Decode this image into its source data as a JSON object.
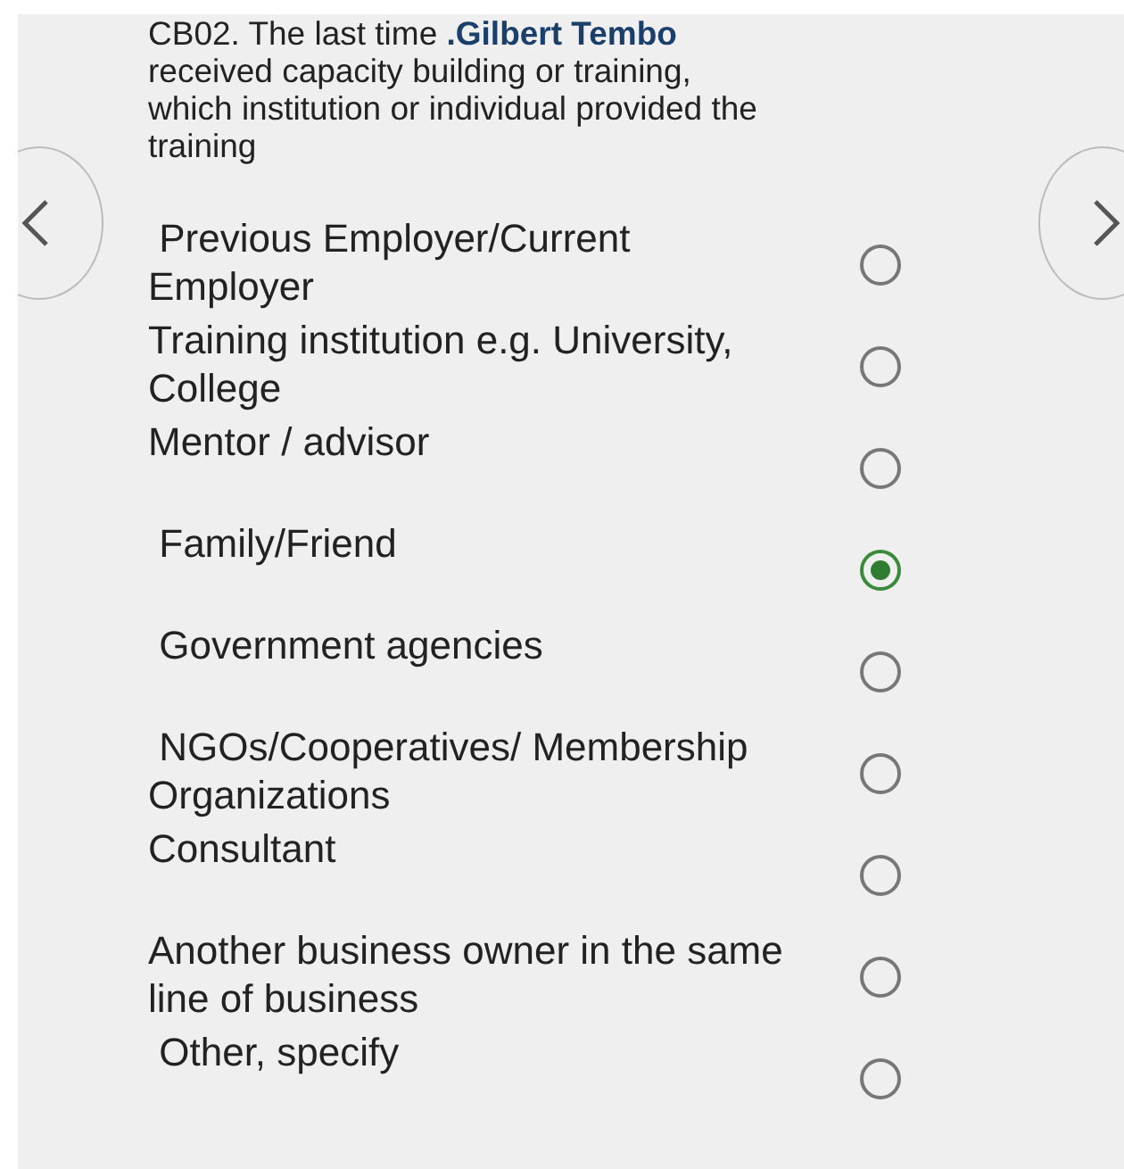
{
  "question": "CB02. The last time **.Gilbert Tembo** received capacity building or training, which institution or individual provided the training",
  "options": [
    {
      "label": " Previous Employer/Current Employer",
      "selected": false
    },
    {
      "label": "Training institution e.g. University, College",
      "selected": false
    },
    {
      "label": "Mentor / advisor",
      "selected": false
    },
    {
      "label": " Family/Friend",
      "selected": true
    },
    {
      "label": " Government agencies",
      "selected": false
    },
    {
      "label": " NGOs/Cooperatives/ Membership Organizations",
      "selected": false
    },
    {
      "label": "Consultant",
      "selected": false
    },
    {
      "label": "Another business owner in the same line of business",
      "selected": false
    },
    {
      "label": " Other, specify",
      "selected": false
    }
  ]
}
